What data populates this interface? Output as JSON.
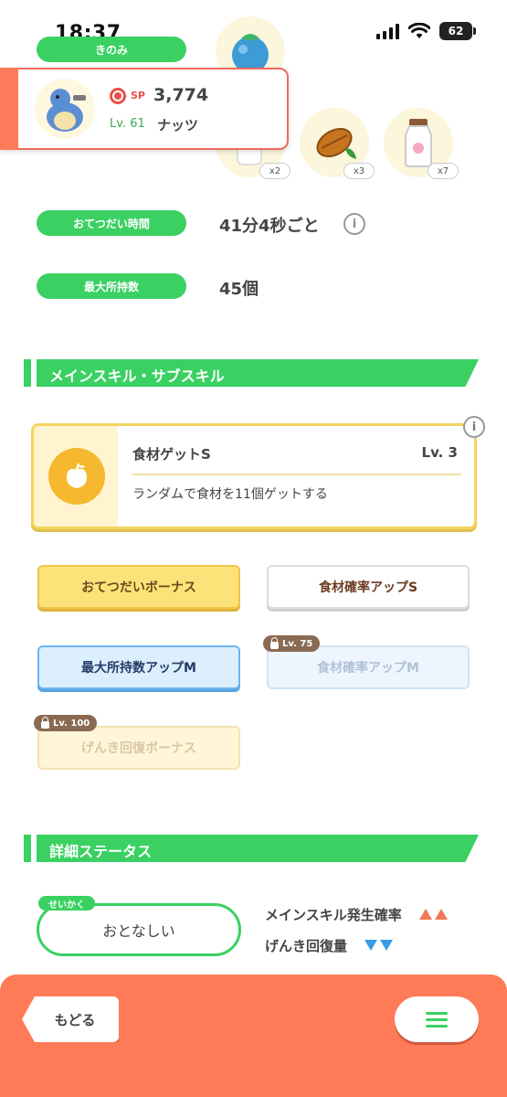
{
  "status_bar": {
    "time": "18:37",
    "battery": "62"
  },
  "fields": {
    "berry_label": "きのみ",
    "help_time_label": "おてつだい時間",
    "help_time_value": "41分4秒ごと",
    "max_carry_label": "最大所持数",
    "max_carry_value": "45個"
  },
  "ingredients": [
    {
      "icon": "ingredient-icon",
      "qty": "x2"
    },
    {
      "icon": "cacao-icon",
      "qty": "x3"
    },
    {
      "icon": "milk-bottle-icon",
      "qty": "x7"
    }
  ],
  "pokemon_card": {
    "sp_label": "SP",
    "sp_value": "3,774",
    "level": "Lv. 61",
    "name": "ナッツ"
  },
  "sections": {
    "skills_title": "メインスキル・サブスキル",
    "details_title": "詳細ステータス"
  },
  "main_skill": {
    "name": "食材ゲットS",
    "level": "Lv. 3",
    "description": "ランダムで食材を11個ゲットする",
    "info": "i"
  },
  "sub_skills": [
    {
      "label": "おてつだいボーナス",
      "style": "gold",
      "lock": ""
    },
    {
      "label": "食材確率アップS",
      "style": "white",
      "lock": ""
    },
    {
      "label": "最大所持数アップM",
      "style": "blue",
      "lock": ""
    },
    {
      "label": "食材確率アップM",
      "style": "blue-locked",
      "lock": "Lv. 75"
    },
    {
      "label": "げんき回復ボーナス",
      "style": "gold-locked",
      "lock": "Lv. 100"
    }
  ],
  "nature": {
    "tag": "せいかく",
    "value": "おとなしい",
    "up_label": "メインスキル発生確率",
    "down_label": "げんき回復量"
  },
  "nav": {
    "back_label": "もどる"
  },
  "colors": {
    "green": "#3ad162",
    "orange": "#ff7a57",
    "gold": "#fde27a",
    "blue": "#6cb6f2"
  }
}
